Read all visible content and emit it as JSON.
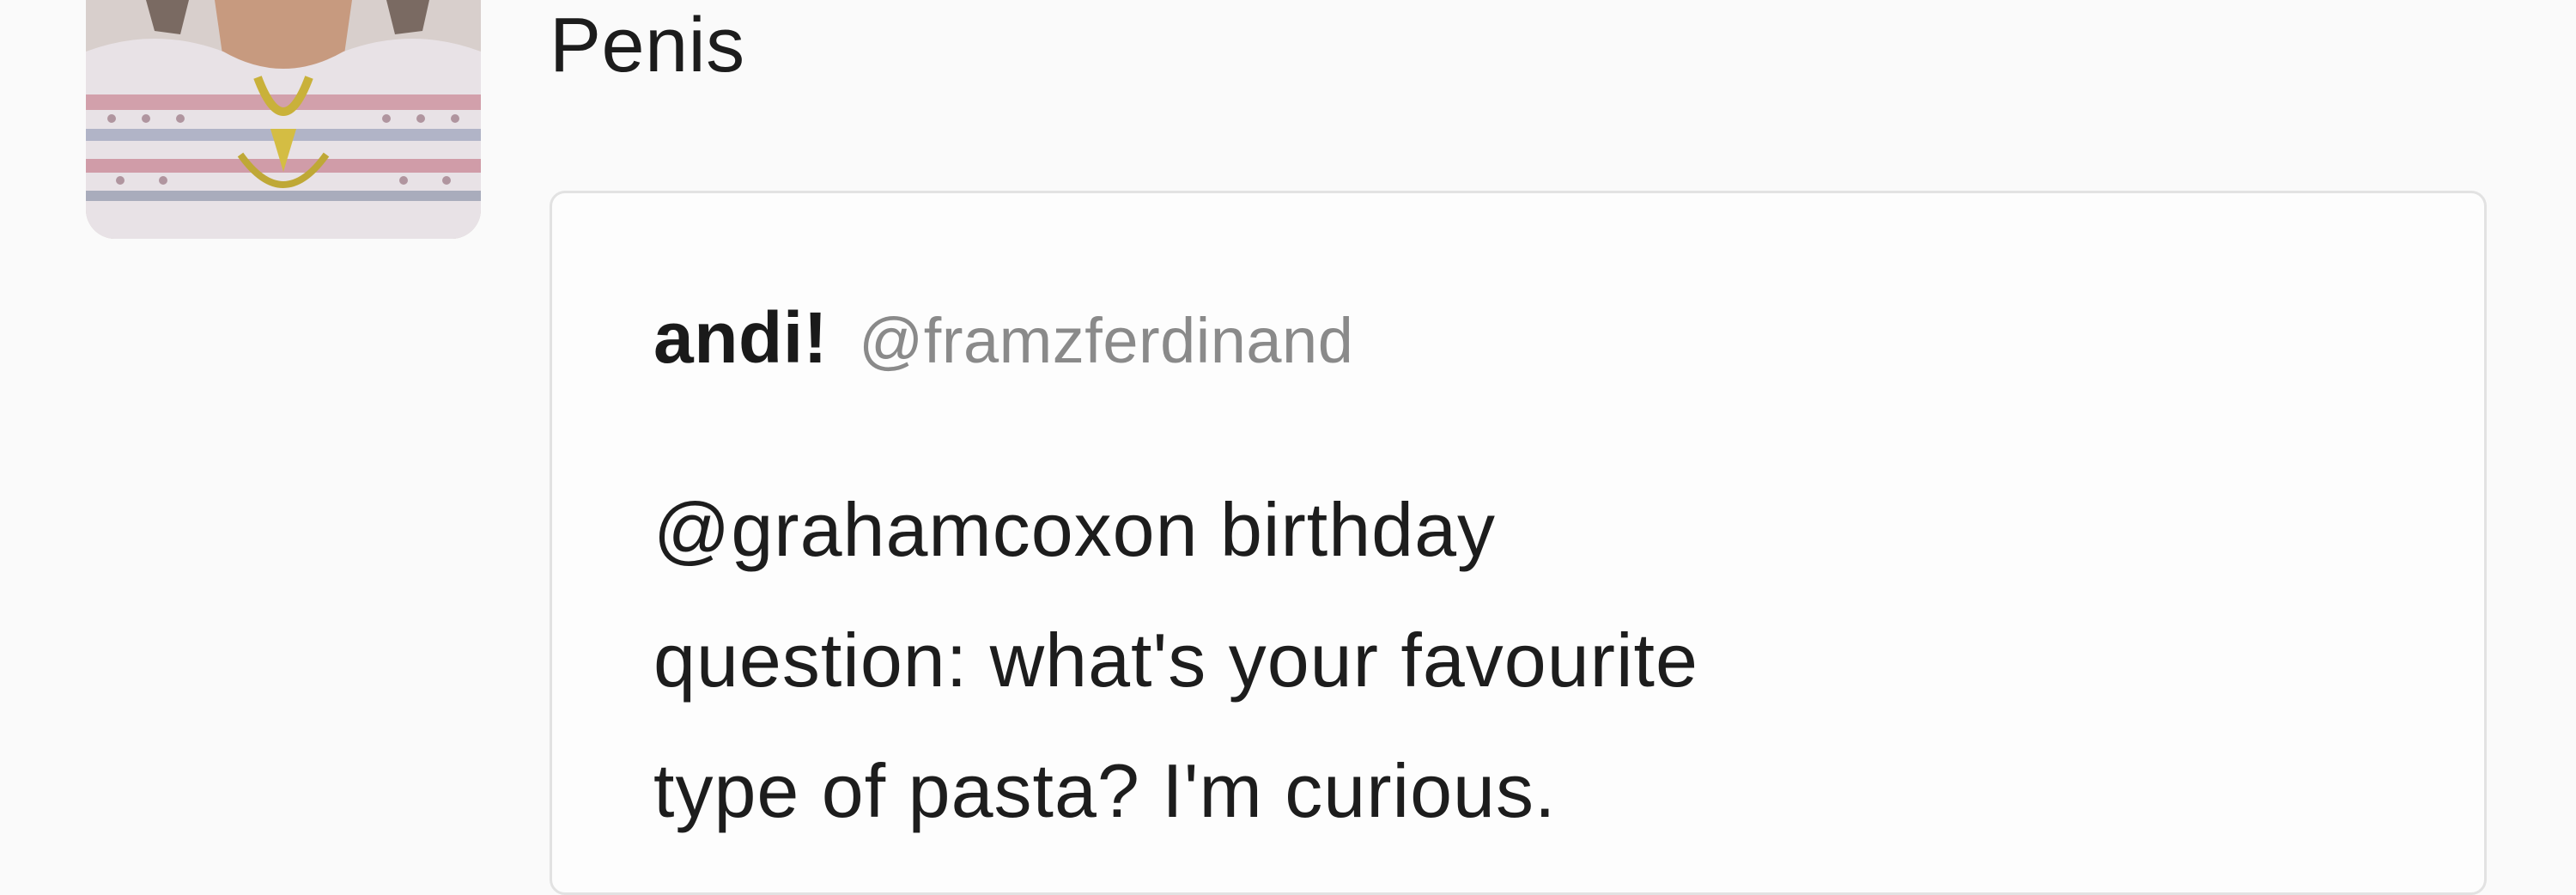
{
  "tweet": {
    "text": "Penis"
  },
  "quoted_tweet": {
    "display_name": "andi!",
    "handle": "@framzferdinand",
    "body_lines": [
      "@grahamcoxon birthday",
      "question: what's your favourite",
      "type of pasta? I'm curious."
    ]
  },
  "colors": {
    "background": "#fafafa",
    "card_border": "#e2e2e2",
    "handle_gray": "#8a8a8a",
    "text_dark": "#1b1b1b"
  },
  "icons": {
    "avatar": "user-avatar-photo"
  }
}
